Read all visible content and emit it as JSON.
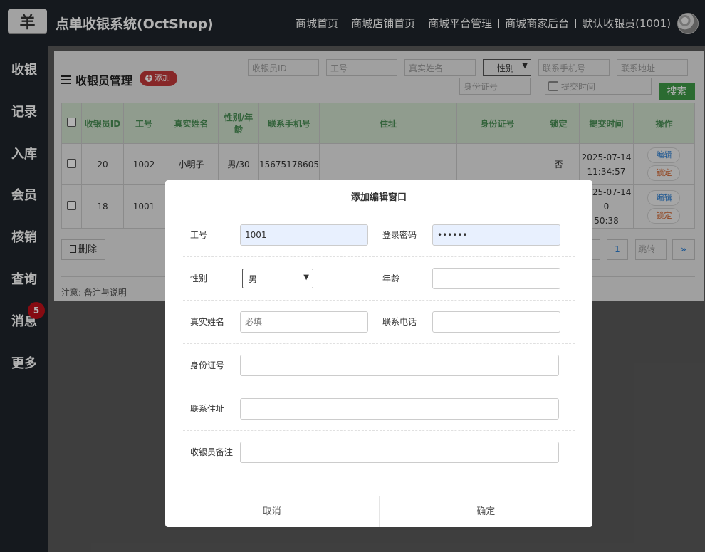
{
  "header": {
    "logo_glyph": "羊",
    "app_title": "点单收银系统(OctShop)",
    "nav": [
      "商城首页",
      "商城店铺首页",
      "商城平台管理",
      "商城商家后台",
      "默认收银员(1001)"
    ]
  },
  "sidebar": {
    "items": [
      "收银",
      "记录",
      "入库",
      "会员",
      "核销",
      "查询",
      "消息",
      "更多"
    ],
    "message_badge": "5"
  },
  "panel": {
    "title": "收银员管理",
    "add_label": "添加",
    "filters": {
      "cashier_id": "收银员ID",
      "job_no": "工号",
      "real_name": "真实姓名",
      "gender": "性别",
      "phone": "联系手机号",
      "address": "联系地址",
      "id_card": "身份证号",
      "submit_time": "提交时间"
    },
    "search_label": "搜索",
    "table": {
      "headers": [
        "收银员ID",
        "工号",
        "真实姓名",
        "性别/年龄",
        "联系手机号",
        "住址",
        "身份证号",
        "锁定",
        "提交时间",
        "操作"
      ],
      "rows": [
        [
          "20",
          "1002",
          "小明子",
          "男/30",
          "15675178605",
          "",
          "",
          "否",
          "2025-07-14 11:34:57"
        ],
        [
          "18",
          "1001",
          "",
          "",
          "",
          "",
          "",
          "",
          "2025-07-14 0\n50:38"
        ]
      ],
      "edit_label": "编辑",
      "lock_label": "锁定"
    },
    "delete_label": "删除",
    "pager": {
      "page": "1",
      "jump": "跳转",
      "next": "»"
    },
    "note": "注意: 备注与说明"
  },
  "modal": {
    "title": "添加编辑窗口",
    "fields": {
      "job_no_label": "工号",
      "job_no_value": "1001",
      "password_label": "登录密码",
      "password_value": "••••••",
      "gender_label": "性别",
      "gender_value": "男",
      "age_label": "年龄",
      "age_value": "",
      "real_name_label": "真实姓名",
      "real_name_placeholder": "必填",
      "phone_label": "联系电话",
      "phone_value": "",
      "id_card_label": "身份证号",
      "address_label": "联系住址",
      "remark_label": "收银员备注"
    },
    "cancel_label": "取消",
    "confirm_label": "确定"
  }
}
